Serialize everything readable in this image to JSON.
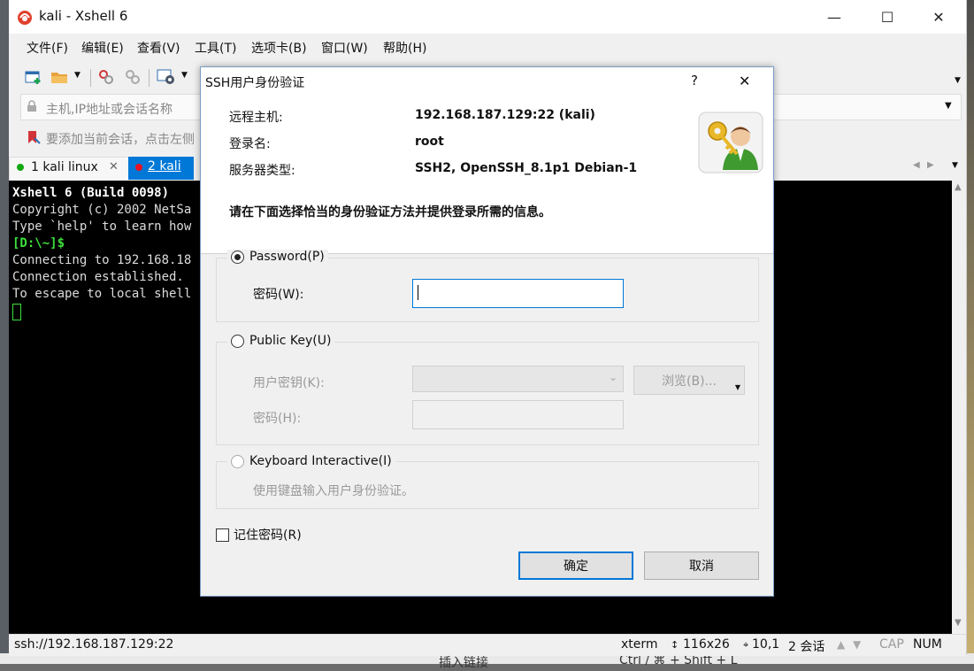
{
  "window": {
    "title": "kali - Xshell 6",
    "controls": {
      "minimize": "—",
      "maximize": "☐",
      "close": "✕"
    }
  },
  "menu": [
    "文件(F)",
    "编辑(E)",
    "查看(V)",
    "工具(T)",
    "选项卡(B)",
    "窗口(W)",
    "帮助(H)"
  ],
  "address_bar": {
    "placeholder": "主机,IP地址或会话名称"
  },
  "hint_bar": {
    "text": "要添加当前会话，点击左侧"
  },
  "tabs": [
    {
      "label": "1 kali linux",
      "status_color": "#12a812"
    },
    {
      "label": "2 kali",
      "status_color": "#e81123"
    }
  ],
  "terminal": {
    "lines": [
      "Xshell 6 (Build 0098)",
      "Copyright (c) 2002 NetSa",
      "",
      "Type `help' to learn how",
      "[D:\\~]$",
      "",
      "Connecting to 192.168.18",
      "Connection established.",
      "To escape to local shell"
    ]
  },
  "status_bar": {
    "connection": "ssh://192.168.187.129:22",
    "term_type": "xterm",
    "size": "116x26",
    "position": "10,1",
    "sessions": "2 会话",
    "cap": "CAP",
    "num": "NUM"
  },
  "background_text": {
    "left": "插入链接",
    "right": "Ctrl / ⌘ + Shift + L"
  },
  "dialog": {
    "title": "SSH用户身份验证",
    "help": "?",
    "close": "✕",
    "info": [
      {
        "label": "远程主机:",
        "value": "192.168.187.129:22 (kali)"
      },
      {
        "label": "登录名:",
        "value": "root"
      },
      {
        "label": "服务器类型:",
        "value": "SSH2, OpenSSH_8.1p1 Debian-1"
      }
    ],
    "instruction": "请在下面选择恰当的身份验证方法并提供登录所需的信息。",
    "password_method": {
      "label": "Password(P)",
      "field_label": "密码(W):",
      "value": ""
    },
    "publickey_method": {
      "label": "Public Key(U)",
      "key_label": "用户密钥(K):",
      "browse": "浏览(B)...",
      "pass_label": "密码(H):"
    },
    "keyboard_method": {
      "label": "Keyboard Interactive(I)",
      "description": "使用键盘输入用户身份验证。"
    },
    "remember": "记住密码(R)",
    "ok": "确定",
    "cancel": "取消"
  }
}
